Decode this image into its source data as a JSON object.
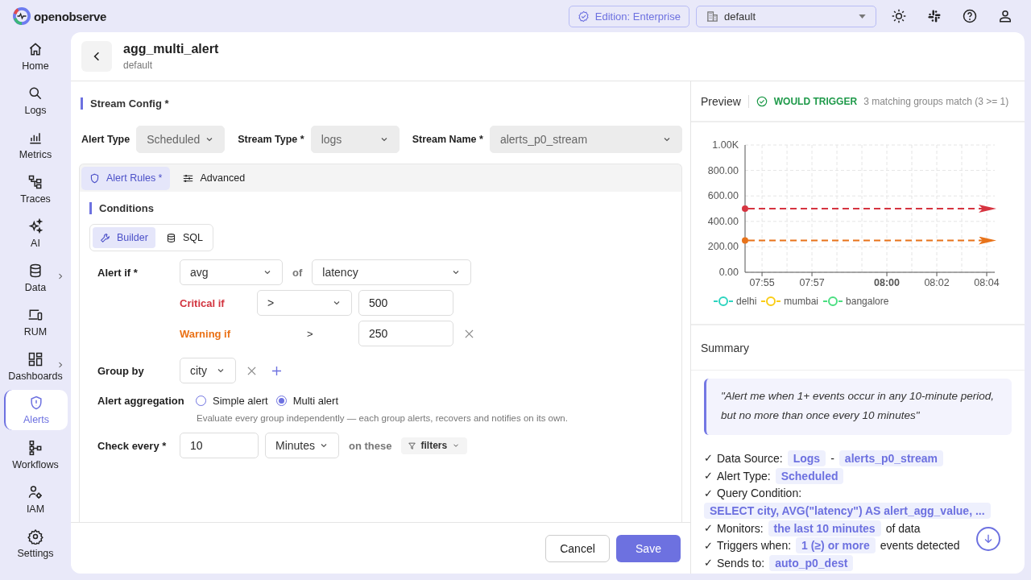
{
  "topbar": {
    "logo": "openobserve",
    "edition": "Edition: Enterprise",
    "org": "default"
  },
  "sidebar": {
    "items": [
      {
        "label": "Home",
        "selected": false,
        "submenu": false
      },
      {
        "label": "Logs",
        "selected": false,
        "submenu": false
      },
      {
        "label": "Metrics",
        "selected": false,
        "submenu": false
      },
      {
        "label": "Traces",
        "selected": false,
        "submenu": false
      },
      {
        "label": "AI",
        "selected": false,
        "submenu": false
      },
      {
        "label": "Data",
        "selected": false,
        "submenu": true
      },
      {
        "label": "RUM",
        "selected": false,
        "submenu": false
      },
      {
        "label": "Dashboards",
        "selected": false,
        "submenu": true
      },
      {
        "label": "Alerts",
        "selected": true,
        "submenu": false
      },
      {
        "label": "Workflows",
        "selected": false,
        "submenu": false
      },
      {
        "label": "IAM",
        "selected": false,
        "submenu": false
      },
      {
        "label": "Settings",
        "selected": false,
        "submenu": false
      }
    ]
  },
  "header": {
    "title": "agg_multi_alert",
    "subtitle": "default"
  },
  "stream_config": {
    "title": "Stream Config *",
    "fields": [
      {
        "label": "Alert Type",
        "value": "Scheduled",
        "disabled": true
      },
      {
        "label": "Stream Type *",
        "value": "logs",
        "disabled": true
      },
      {
        "label": "Stream Name *",
        "value": "alerts_p0_stream",
        "disabled": true
      }
    ]
  },
  "tabs": [
    {
      "label": "Alert Rules *",
      "selected": true
    },
    {
      "label": "Advanced",
      "selected": false
    }
  ],
  "conditions": {
    "title": "Conditions",
    "modes": [
      {
        "label": "Builder",
        "selected": true
      },
      {
        "label": "SQL",
        "selected": false
      }
    ],
    "alert_if": {
      "label": "Alert if *",
      "function": "avg",
      "connector": "of",
      "column": "latency"
    },
    "thresholds": [
      {
        "kind": "critical",
        "label": "Critical if",
        "operator": ">",
        "operator_editable": true,
        "value": "500",
        "removable": false
      },
      {
        "kind": "warning",
        "label": "Warning if",
        "operator": ">",
        "operator_editable": false,
        "value": "250",
        "removable": true
      }
    ],
    "group_by": {
      "label": "Group by",
      "values": [
        "city"
      ]
    },
    "aggregation": {
      "label": "Alert aggregation",
      "options": [
        {
          "label": "Simple alert",
          "selected": false
        },
        {
          "label": "Multi alert",
          "selected": true
        }
      ],
      "hint": "Evaluate every group independently — each group alerts, recovers and notifies on its own."
    },
    "check_every": {
      "label": "Check every *",
      "value": "10",
      "unit": "Minutes",
      "connector": "on these",
      "filters": "filters"
    }
  },
  "footer": {
    "buttons": [
      {
        "label": "Cancel",
        "kind": "secondary"
      },
      {
        "label": "Save",
        "kind": "primary"
      }
    ]
  },
  "preview": {
    "title": "Preview",
    "status": "WOULD TRIGGER",
    "detail": "3 matching groups match (3 >= 1)",
    "chart_data": {
      "type": "line",
      "categories": [
        "07:55",
        null,
        "07:57",
        null,
        null,
        "08:00",
        null,
        "08:02",
        null,
        "08:04"
      ],
      "ylim": [
        0,
        1000
      ],
      "yticks": [
        {
          "value": 0,
          "label": "0.00"
        },
        {
          "value": 200,
          "label": "200.00"
        },
        {
          "value": 400,
          "label": "400.00"
        },
        {
          "value": 600,
          "label": "600.00"
        },
        {
          "value": 800,
          "label": "800.00"
        },
        {
          "value": 1000,
          "label": "1.00K"
        }
      ],
      "series": [
        {
          "name": "delhi",
          "color": "#2dd4bf",
          "values": [
            null,
            null,
            null,
            null,
            null,
            null,
            null,
            null,
            null,
            null
          ]
        },
        {
          "name": "mumbai",
          "color": "#facc15",
          "values": [
            null,
            null,
            null,
            null,
            null,
            null,
            null,
            null,
            null,
            null
          ]
        },
        {
          "name": "bangalore",
          "color": "#4ade80",
          "values": [
            null,
            null,
            null,
            null,
            null,
            null,
            null,
            null,
            null,
            null
          ]
        }
      ],
      "grid": true,
      "ref_lines": [
        {
          "axis": "y",
          "value": 500,
          "color": "#d63440"
        },
        {
          "axis": "y",
          "value": 250,
          "color": "#e8731a"
        }
      ]
    }
  },
  "summary": {
    "title": "Summary",
    "quote": "\"Alert me when 1+ events occur in any 10-minute period, but no more than once every 10 minutes\"",
    "lines": [
      {
        "mark": "✓",
        "parts": [
          {
            "kind": "text",
            "text": "Data Source:"
          },
          {
            "kind": "chip",
            "text": "Logs"
          },
          {
            "kind": "text",
            "text": "-"
          },
          {
            "kind": "chip",
            "text": "alerts_p0_stream"
          }
        ]
      },
      {
        "mark": "✓",
        "parts": [
          {
            "kind": "text",
            "text": "Alert Type:"
          },
          {
            "kind": "chip",
            "text": "Scheduled"
          }
        ]
      },
      {
        "mark": "✓",
        "parts": [
          {
            "kind": "text",
            "text": "Query Condition:"
          }
        ]
      },
      {
        "parts": [
          {
            "kind": "chip",
            "text": "SELECT city, AVG(\"latency\") AS alert_agg_value, ..."
          }
        ]
      },
      {
        "mark": "✓",
        "parts": [
          {
            "kind": "text",
            "text": "Monitors:"
          },
          {
            "kind": "chip",
            "text": "the last 10 minutes"
          },
          {
            "kind": "text",
            "text": "of data"
          }
        ]
      },
      {
        "mark": "✓",
        "parts": [
          {
            "kind": "text",
            "text": "Triggers when:"
          },
          {
            "kind": "chip",
            "text": "1 (≥) or more"
          },
          {
            "kind": "text",
            "text": "events detected"
          }
        ]
      },
      {
        "mark": "✓",
        "parts": [
          {
            "kind": "text",
            "text": "Sends to:"
          },
          {
            "kind": "chip",
            "text": "auto_p0_dest"
          }
        ]
      }
    ]
  }
}
